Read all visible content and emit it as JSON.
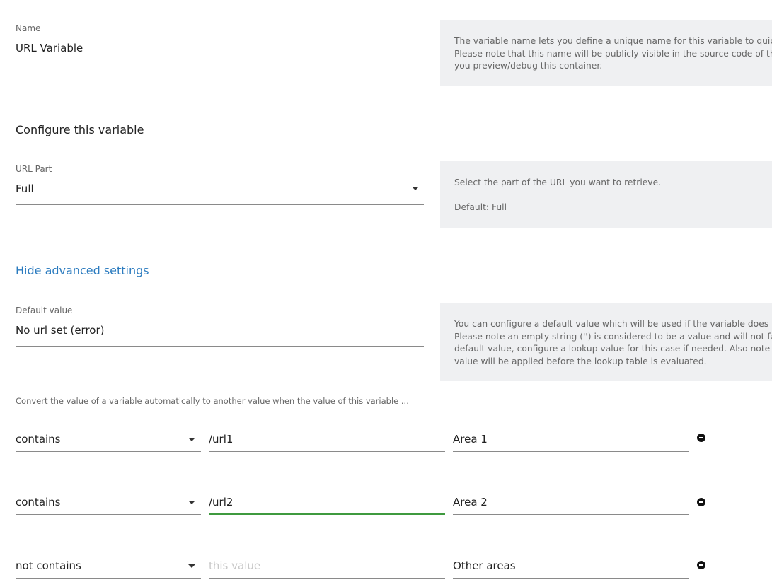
{
  "name_field": {
    "label": "Name",
    "value": "URL Variable",
    "help_lines": [
      "The variable name lets you define a unique name for this variable to quickly i",
      "Please note that this name will be publicly visible in the source code of the va",
      "you preview/debug this container."
    ]
  },
  "configure": {
    "title": "Configure this variable"
  },
  "url_part_field": {
    "label": "URL Part",
    "value": "Full",
    "help_lines": [
      "Select the part of the URL you want to retrieve.",
      "",
      "Default: Full"
    ]
  },
  "advanced": {
    "toggle_label": "Hide advanced settings"
  },
  "default_value_field": {
    "label": "Default value",
    "value": "No url set (error)",
    "help_lines": [
      "You can configure a default value which will be used if the variable does not r",
      "Please note an empty string ('') is considered to be a value and will not fall ba",
      "default value, configure a lookup value for this case if needed. Also note that",
      "value will be applied before the lookup table is evaluated."
    ]
  },
  "lookup": {
    "description": "Convert the value of a variable automatically to another value when the value of this variable ...",
    "rows": [
      {
        "operator": "contains",
        "value": "/url1",
        "placeholder": "this value",
        "result": "Area 1"
      },
      {
        "operator": "contains",
        "value": "/url2",
        "placeholder": "this value",
        "result": "Area 2"
      },
      {
        "operator": "not contains",
        "value": "",
        "placeholder": "this value",
        "result": "Other areas"
      }
    ]
  },
  "colors": {
    "link": "#2b7bbf",
    "focus_underline": "#3f9a3f",
    "help_background": "#eff0f2"
  }
}
